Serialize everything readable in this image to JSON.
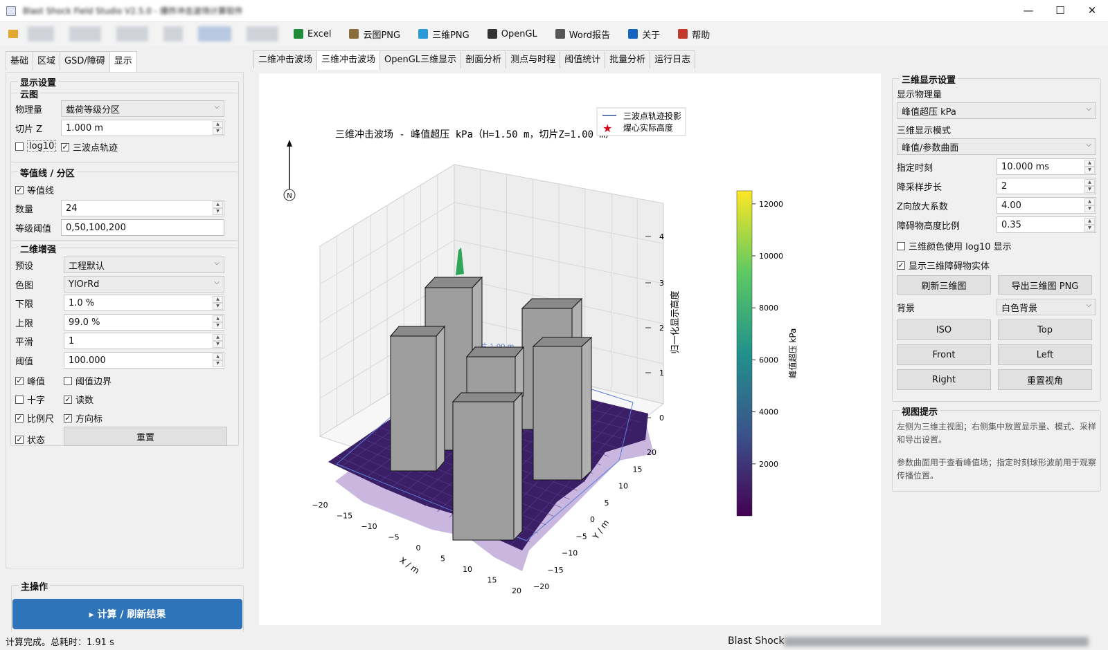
{
  "titlebar": {
    "title": "Blast Shock Field Studio V2.5.0 - 爆炸冲击波场计算软件",
    "minimize": "—",
    "maximize": "☐",
    "close": "✕"
  },
  "toolbar": {
    "items": [
      {
        "label": "Excel",
        "icon": "excel-icon",
        "color": "#1f8a3a"
      },
      {
        "label": "云图PNG",
        "icon": "image-icon",
        "color": "#8a6d3b"
      },
      {
        "label": "三维PNG",
        "icon": "globe-icon",
        "color": "#2a9ad6"
      },
      {
        "label": "OpenGL",
        "icon": "monitor-icon",
        "color": "#333333"
      },
      {
        "label": "Word报告",
        "icon": "document-icon",
        "color": "#555555"
      },
      {
        "label": "关于",
        "icon": "info-icon",
        "color": "#1565c0"
      },
      {
        "label": "帮助",
        "icon": "help-icon",
        "color": "#c0392b"
      }
    ]
  },
  "left": {
    "tabs": [
      "基础",
      "区域",
      "GSD/障碍",
      "显示"
    ],
    "section_title": "显示设置",
    "cloud": {
      "title": "云图",
      "quantity_label": "物理量",
      "quantity_value": "载荷等级分区",
      "slice_label": "切片 Z",
      "slice_value": "1.000 m",
      "log10_label": "log10",
      "log10_checked": false,
      "track_label": "三波点轨迹",
      "track_checked": true
    },
    "contour": {
      "title": "等值线 / 分区",
      "contour_label": "等值线",
      "contour_checked": true,
      "count_label": "数量",
      "count_value": "24",
      "levels_label": "等级阈值",
      "levels_value": "0,50,100,200"
    },
    "enhance": {
      "title": "二维增强",
      "preset_label": "预设",
      "preset_value": "工程默认",
      "cmap_label": "色图",
      "cmap_value": "YlOrRd",
      "lower_label": "下限",
      "lower_value": "1.0 %",
      "upper_label": "上限",
      "upper_value": "99.0 %",
      "smooth_label": "平滑",
      "smooth_value": "1",
      "thresh_label": "阈值",
      "thresh_value": "100.000",
      "peak_label": "峰值",
      "peak_checked": true,
      "boundary_label": "阈值边界",
      "boundary_checked": false,
      "cross_label": "十字",
      "cross_checked": false,
      "readout_label": "读数",
      "readout_checked": true,
      "scale_label": "比例尺",
      "scale_checked": true,
      "north_label": "方向标",
      "north_checked": true,
      "status_label": "状态",
      "status_checked": true,
      "reset_label": "重置"
    },
    "main_title": "主操作",
    "compute_label": "▸  计算 / 刷新结果"
  },
  "center": {
    "tabs": [
      "二维冲击波场",
      "三维冲击波场",
      "OpenGL三维显示",
      "剖面分析",
      "测点与时程",
      "阈值统计",
      "批量分析",
      "运行日志"
    ],
    "active_tab": 1
  },
  "plot": {
    "title": "三维冲击波场 - 峰值超压 kPa（H=1.50 m，切片Z=1.00 m）",
    "legend": [
      "三波点轨迹投影",
      "爆心实际高度"
    ],
    "north_label": "N",
    "slice_annotation": "切片 1.00 m",
    "xlabel": "X / m",
    "ylabel": "Y / m",
    "zlabel": "归一化显示高度",
    "colorbar_label": "峰值超压 kPa",
    "x_ticks": [
      "−20",
      "−15",
      "−10",
      "−5",
      "0",
      "5",
      "10",
      "15",
      "20"
    ],
    "y_ticks": [
      "−20",
      "−15",
      "−10",
      "−5",
      "0",
      "5",
      "10",
      "15",
      "20"
    ],
    "z_ticks": [
      "0",
      "1",
      "2",
      "3",
      "4"
    ],
    "cbar_ticks": [
      "2000",
      "4000",
      "6000",
      "8000",
      "10000",
      "12000"
    ],
    "colors": {
      "surface": "#3b1f66",
      "shadow": "#b79fd4",
      "building": "#9e9e9e",
      "building_top": "#8a8a8a",
      "building_edge": "#111111",
      "star": "#d0021b",
      "track": "#2d4f9e"
    }
  },
  "right": {
    "group_title": "三维显示设置",
    "quantity_label": "显示物理量",
    "quantity_value": "峰值超压 kPa",
    "mode_label": "三维显示模式",
    "mode_value": "峰值/参数曲面",
    "time_label": "指定时刻",
    "time_value": "10.000 ms",
    "step_label": "降采样步长",
    "step_value": "2",
    "zscale_label": "Z向放大系数",
    "zscale_value": "4.00",
    "hratio_label": "障碍物高度比例",
    "hratio_value": "0.35",
    "log10_label": "三维颜色使用 log10 显示",
    "log10_checked": false,
    "solid_label": "显示三维障碍物实体",
    "solid_checked": true,
    "refresh_label": "刷新三维图",
    "export_label": "导出三维图 PNG",
    "bg_label": "背景",
    "bg_value": "白色背景",
    "iso_label": "ISO",
    "top_label": "Top",
    "front_label": "Front",
    "left_label": "Left",
    "right_label": "Right",
    "resetview_label": "重置视角",
    "hint_title": "视图提示",
    "hint1": "左侧为三维主视图；右侧集中放置显示量、模式、采样和导出设置。",
    "hint2": "参数曲面用于查看峰值场；指定时刻球形波前用于观察传播位置。"
  },
  "status": {
    "left": "计算完成。总耗时：1.91 s",
    "right": "Blast Shock"
  }
}
